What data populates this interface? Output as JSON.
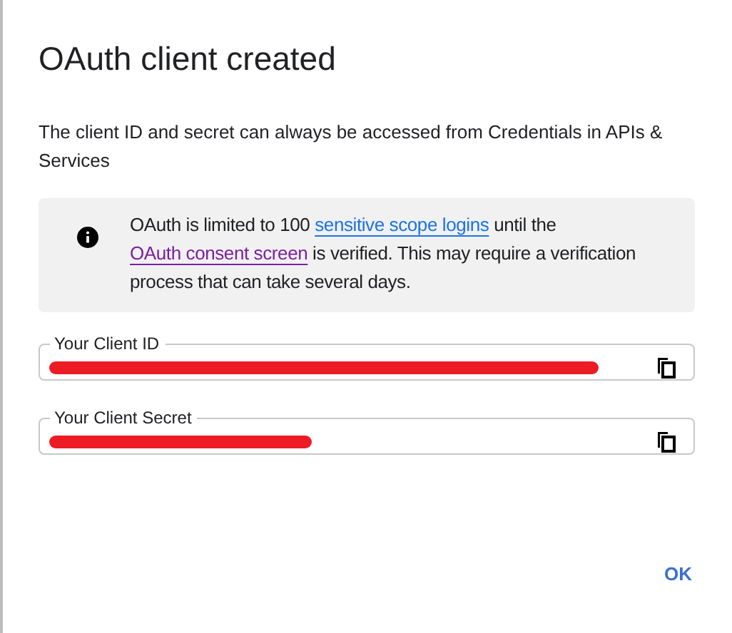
{
  "dialog": {
    "title": "OAuth client created",
    "description": "The client ID and secret can always be accessed from Credentials in APIs & Services",
    "notice": {
      "segments": [
        {
          "kind": "text",
          "text": "OAuth is limited to 100 "
        },
        {
          "kind": "link",
          "text": "sensitive scope logins",
          "visited": false
        },
        {
          "kind": "text",
          "text": " until the "
        },
        {
          "kind": "link",
          "text": "OAuth consent screen",
          "visited": true
        },
        {
          "kind": "text",
          "text": " is verified. This may require a verification process that can take several days."
        }
      ]
    },
    "fields": [
      {
        "label": "Your Client ID"
      },
      {
        "label": "Your Client Secret"
      }
    ],
    "buttons": [
      "OK"
    ]
  }
}
